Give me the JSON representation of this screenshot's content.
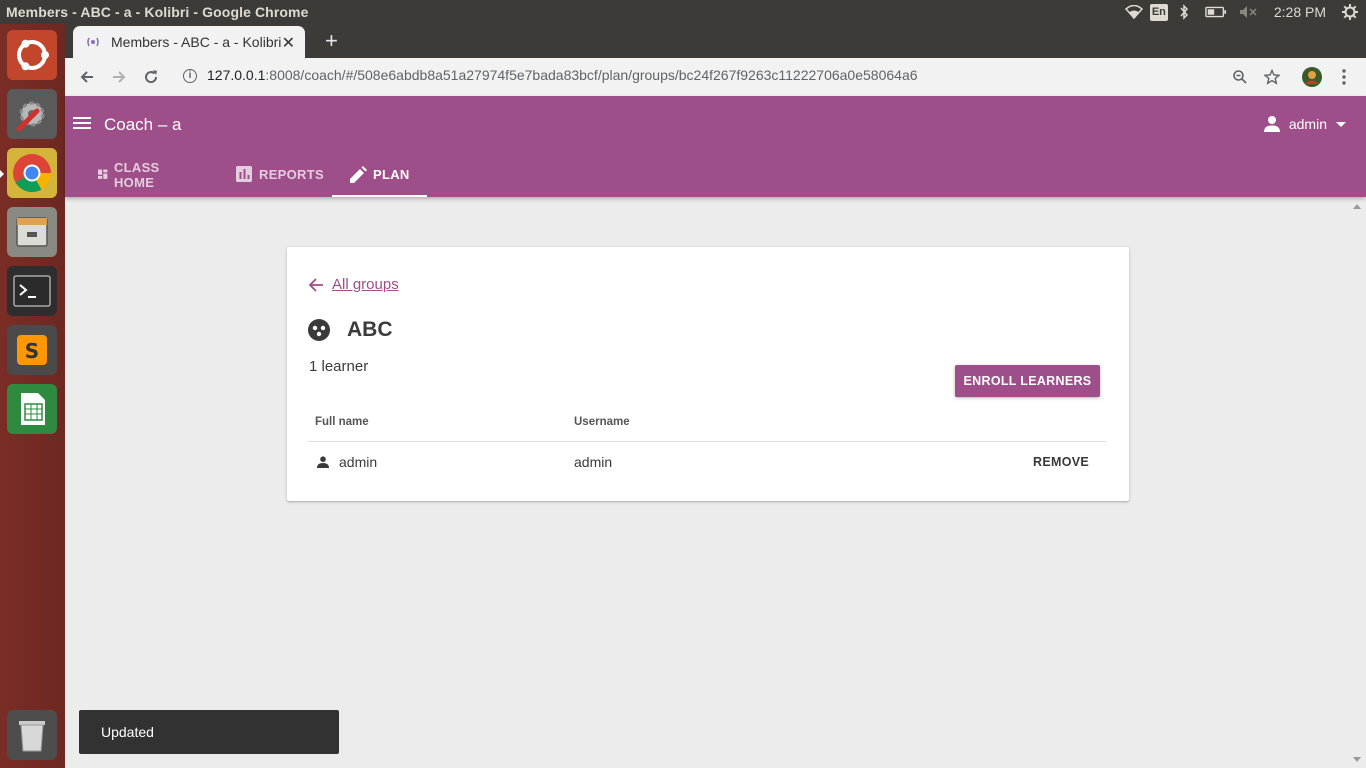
{
  "os": {
    "window_title": "Members - ABC - a - Kolibri - Google Chrome",
    "lang_indicator": "En",
    "clock": "2:28 PM"
  },
  "browser": {
    "tab_title": "Members - ABC - a - Kolibri",
    "url_host": "127.0.0.1",
    "url_rest": ":8008/coach/#/508e6abdb8a51a27974f5e7bada83bcf/plan/groups/bc24f267f9263c11222706a0e58064a6"
  },
  "appbar": {
    "title": "Coach – a",
    "user": "admin"
  },
  "nav": {
    "tabs": [
      {
        "label": "CLASS HOME",
        "active": false
      },
      {
        "label": "REPORTS",
        "active": false
      },
      {
        "label": "PLAN",
        "active": true
      }
    ]
  },
  "group": {
    "back_label": "All groups",
    "name": "ABC",
    "learner_count": "1 learner",
    "enroll_label": "ENROLL LEARNERS",
    "columns": [
      "Full name",
      "Username"
    ],
    "rows": [
      {
        "full_name": "admin",
        "username": "admin",
        "action": "REMOVE"
      }
    ]
  },
  "snackbar": {
    "message": "Updated"
  },
  "colors": {
    "brand": "#9e4e89",
    "launcher": "#7a2d25"
  }
}
